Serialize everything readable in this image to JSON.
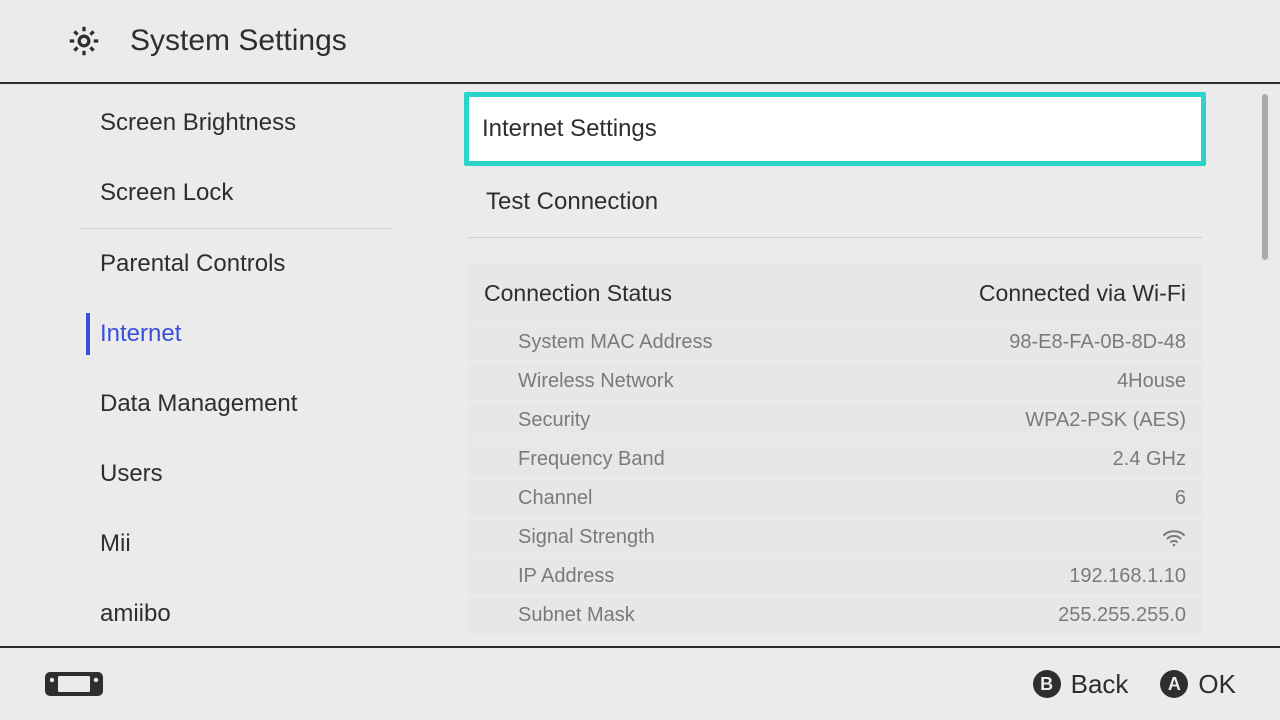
{
  "header": {
    "title": "System Settings"
  },
  "sidebar": {
    "items": [
      {
        "label": "Screen Brightness",
        "active": false
      },
      {
        "label": "Screen Lock",
        "active": false
      },
      {
        "label": "Parental Controls",
        "active": false
      },
      {
        "label": "Internet",
        "active": true
      },
      {
        "label": "Data Management",
        "active": false
      },
      {
        "label": "Users",
        "active": false
      },
      {
        "label": "Mii",
        "active": false
      },
      {
        "label": "amiibo",
        "active": false
      }
    ]
  },
  "content": {
    "menu": [
      {
        "label": "Internet Settings",
        "selected": true
      },
      {
        "label": "Test Connection",
        "selected": false
      }
    ],
    "status": {
      "title": "Connection Status",
      "summary": "Connected via Wi-Fi",
      "rows": [
        {
          "label": "System MAC Address",
          "value": "98-E8-FA-0B-8D-48"
        },
        {
          "label": "Wireless Network",
          "value": "4House"
        },
        {
          "label": "Security",
          "value": "WPA2-PSK (AES)"
        },
        {
          "label": "Frequency Band",
          "value": "2.4 GHz"
        },
        {
          "label": "Channel",
          "value": "6"
        },
        {
          "label": "Signal Strength",
          "value": ""
        },
        {
          "label": "IP Address",
          "value": "192.168.1.10"
        },
        {
          "label": "Subnet Mask",
          "value": "255.255.255.0"
        }
      ]
    }
  },
  "footer": {
    "back_key": "B",
    "back_label": "Back",
    "ok_key": "A",
    "ok_label": "OK"
  }
}
